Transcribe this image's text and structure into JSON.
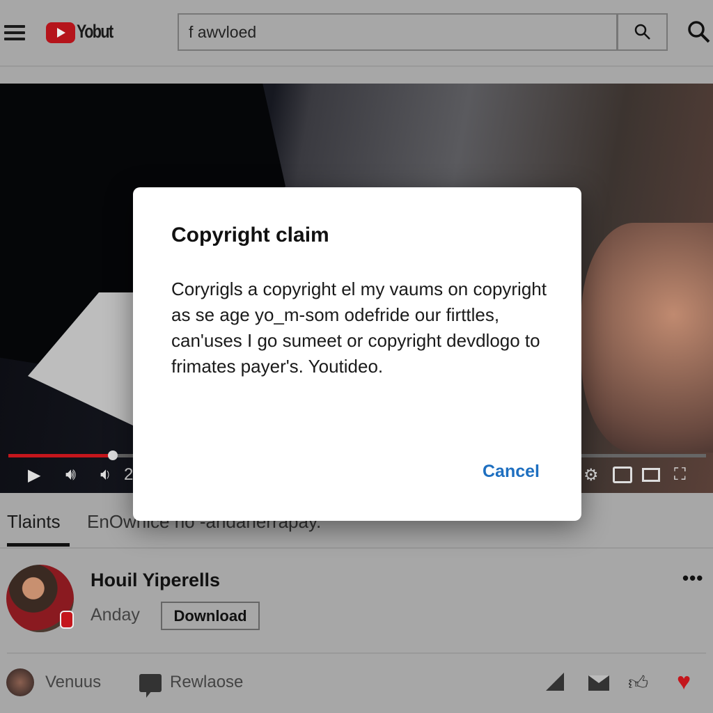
{
  "header": {
    "logo_text": "Yobut",
    "search_value": "f awvloed"
  },
  "player": {
    "time_partial": "2"
  },
  "tabs": [
    {
      "label": "Tlaints",
      "active": true
    },
    {
      "label": "EnOwnice no -andanerrapay."
    }
  ],
  "channel": {
    "name": "Houil Yiperells",
    "subtitle": "Anday",
    "download_label": "Download",
    "more_label": "•••"
  },
  "comment_row": {
    "user": "Venuus",
    "reply_label": "Rewlaose",
    "heart_color": "#c4161c"
  },
  "dialog": {
    "title": "Copyright claim",
    "body": "Coryrigls a copyright el my vaums on copyright as se age yo_m-som odefride our firttles, can'uses I go sumeet or copyright devdlogo to frimates payer's. Youtideo.",
    "cancel_label": "Cancel",
    "accent": "#1e6fc0"
  },
  "colors": {
    "brand": "#b5141b",
    "progress": "#c4161c"
  },
  "progress_fraction": 0.15
}
